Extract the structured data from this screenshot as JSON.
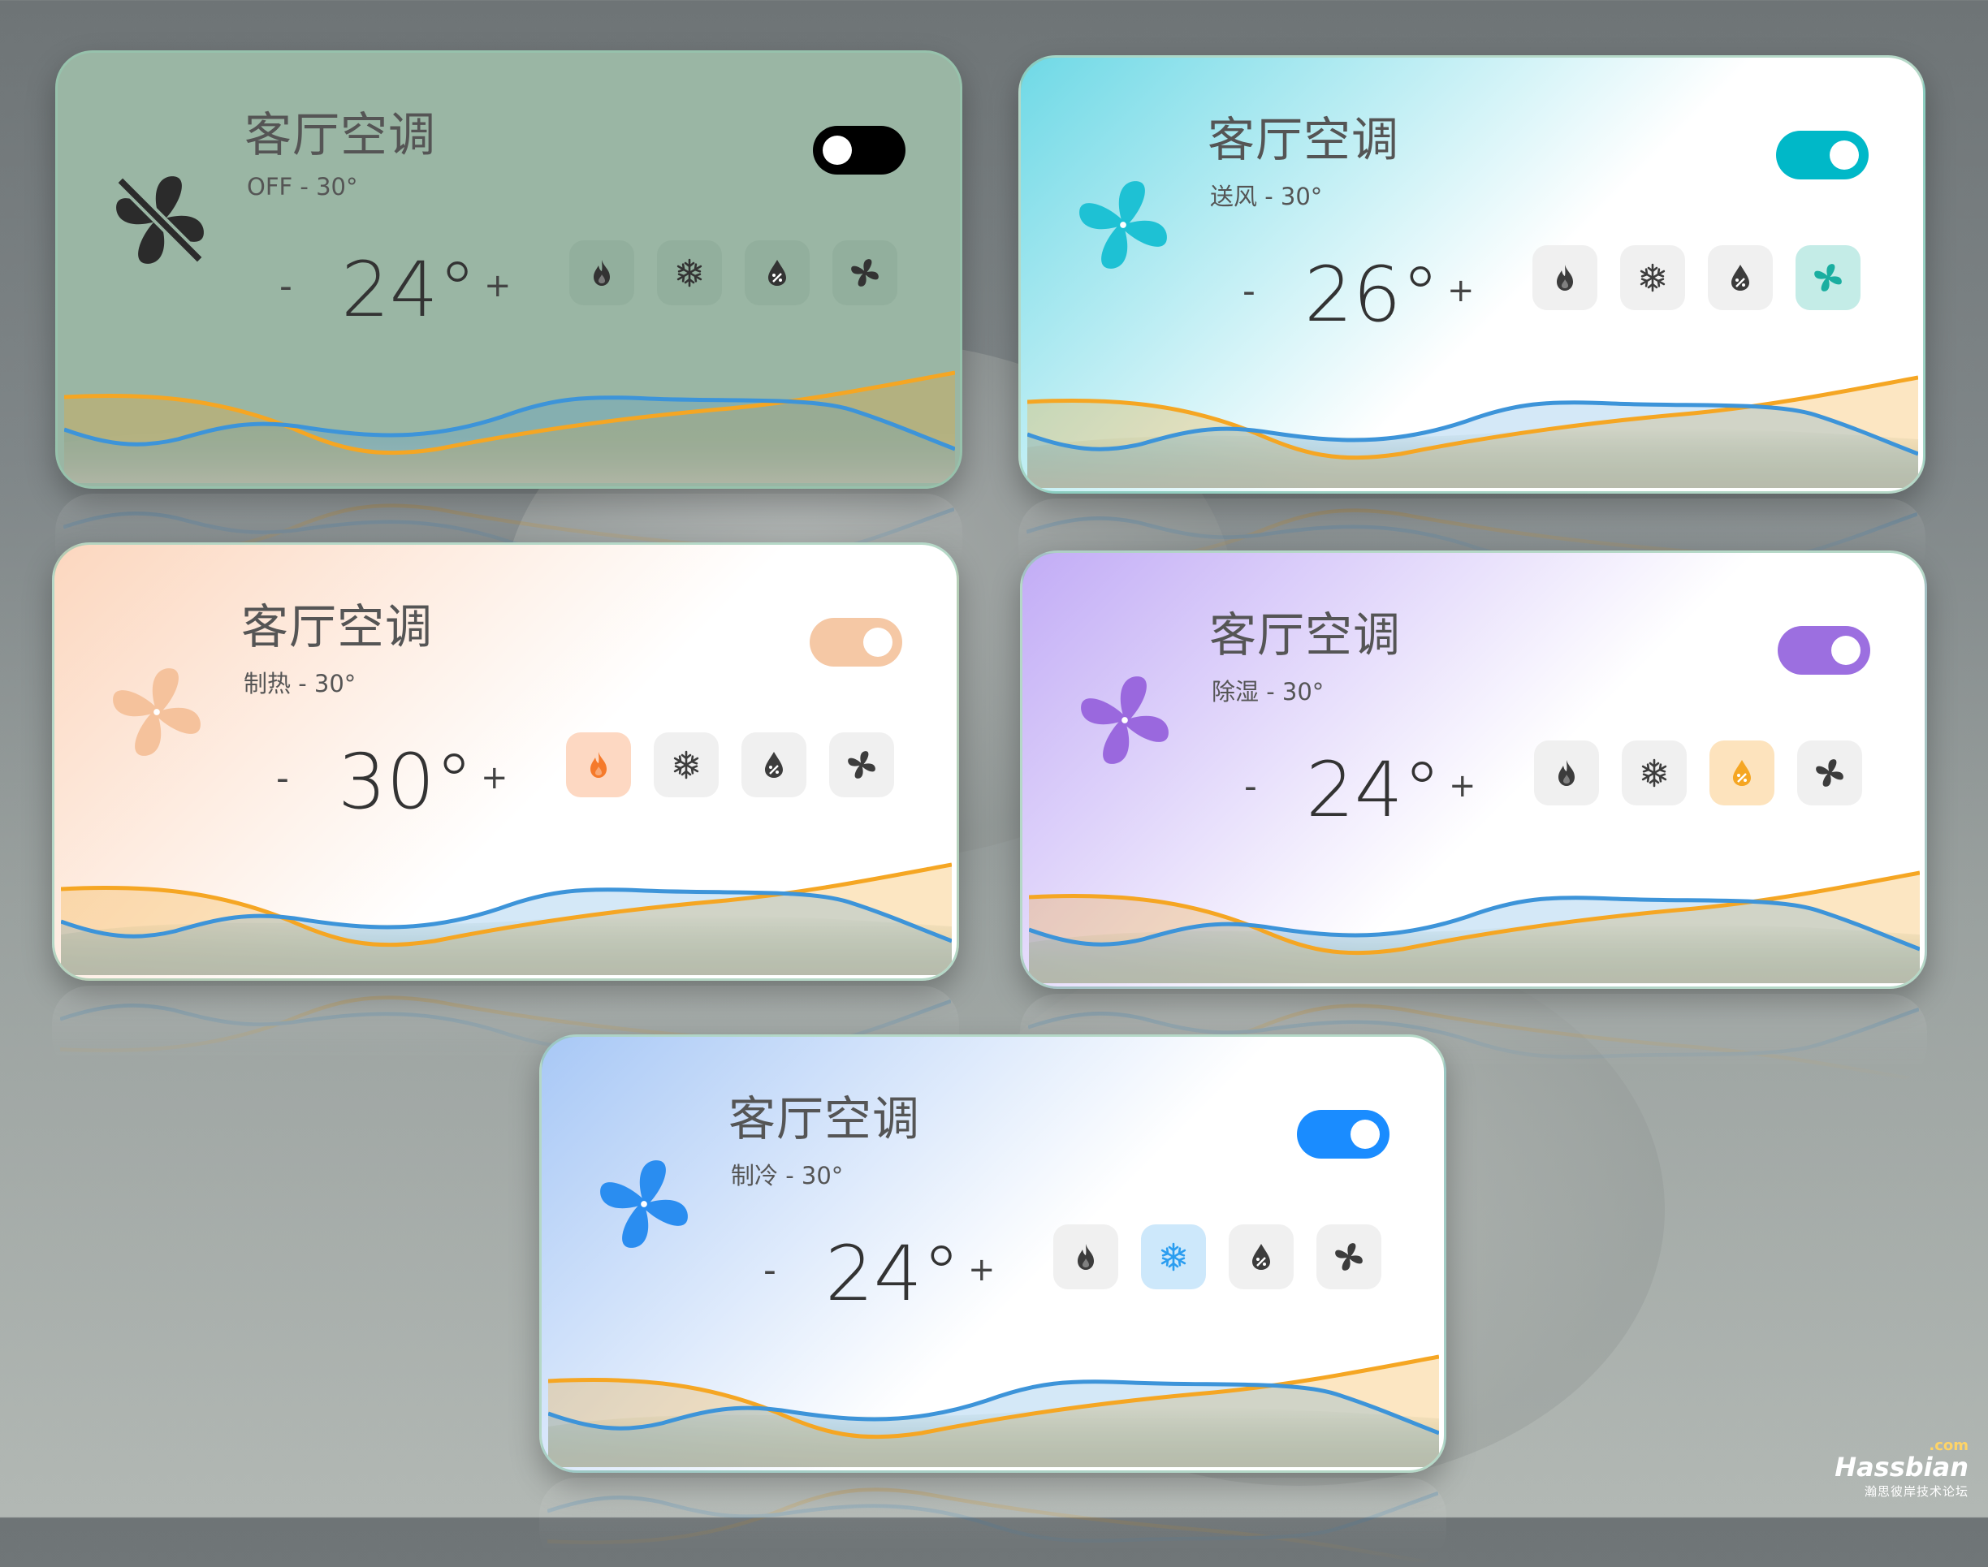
{
  "cards": [
    {
      "title": "客厅空调",
      "status": "OFF - 30°",
      "temperature": "24°",
      "minus_label": "-",
      "plus_label": "+",
      "power_on": false,
      "fan_icon": "fan-off-icon",
      "active_mode": null,
      "colors": {
        "accent": "#000000",
        "icon": "#2b2b2b",
        "bg_start": "#9ab6a4",
        "bg_end": "#9ab6a4"
      }
    },
    {
      "title": "客厅空调",
      "status": "送风 - 30°",
      "temperature": "26°",
      "minus_label": "-",
      "plus_label": "+",
      "power_on": true,
      "fan_icon": "fan-icon",
      "active_mode": "fan",
      "colors": {
        "accent": "#00b8c8",
        "icon": "#1ec1d4",
        "bg_start": "#6fd9e6",
        "bg_end": "#ffffff"
      }
    },
    {
      "title": "客厅空调",
      "status": "制热 - 30°",
      "temperature": "30°",
      "minus_label": "-",
      "plus_label": "+",
      "power_on": true,
      "fan_icon": "fan-icon",
      "active_mode": "heat",
      "colors": {
        "accent": "#f5c8a5",
        "icon": "#f5c29c",
        "bg_start": "#fcd7bf",
        "bg_end": "#ffffff"
      }
    },
    {
      "title": "客厅空调",
      "status": "除湿 - 30°",
      "temperature": "24°",
      "minus_label": "-",
      "plus_label": "+",
      "power_on": true,
      "fan_icon": "fan-icon",
      "active_mode": "dry",
      "colors": {
        "accent": "#9c6fe0",
        "icon": "#9a68de",
        "bg_start": "#c2acf6",
        "bg_end": "#ffffff"
      }
    },
    {
      "title": "客厅空调",
      "status": "制冷 - 30°",
      "temperature": "24°",
      "minus_label": "-",
      "plus_label": "+",
      "power_on": true,
      "fan_icon": "fan-icon",
      "active_mode": "cool",
      "colors": {
        "accent": "#1a8cff",
        "icon": "#2a8df0",
        "bg_start": "#a8c8f6",
        "bg_end": "#ffffff"
      }
    }
  ],
  "modes": [
    {
      "id": "heat",
      "icon": "flame-icon",
      "active_bg": "#fdd8c2",
      "active_color": "#f57a2b"
    },
    {
      "id": "cool",
      "icon": "snowflake-icon",
      "active_bg": "#cde8fb",
      "active_color": "#2a9df0"
    },
    {
      "id": "dry",
      "icon": "water-drop-icon",
      "active_bg": "#fde3bd",
      "active_color": "#f5a623"
    },
    {
      "id": "fan",
      "icon": "fan-icon",
      "active_bg": "#c4ece7",
      "active_color": "#1aaea0"
    }
  ],
  "series_colors": {
    "orange": "#f5a623",
    "blue": "#3d94d9"
  },
  "watermark": {
    "brand": "Hassbian",
    "domain": ".com",
    "tagline": "瀚思彼岸技术论坛"
  }
}
